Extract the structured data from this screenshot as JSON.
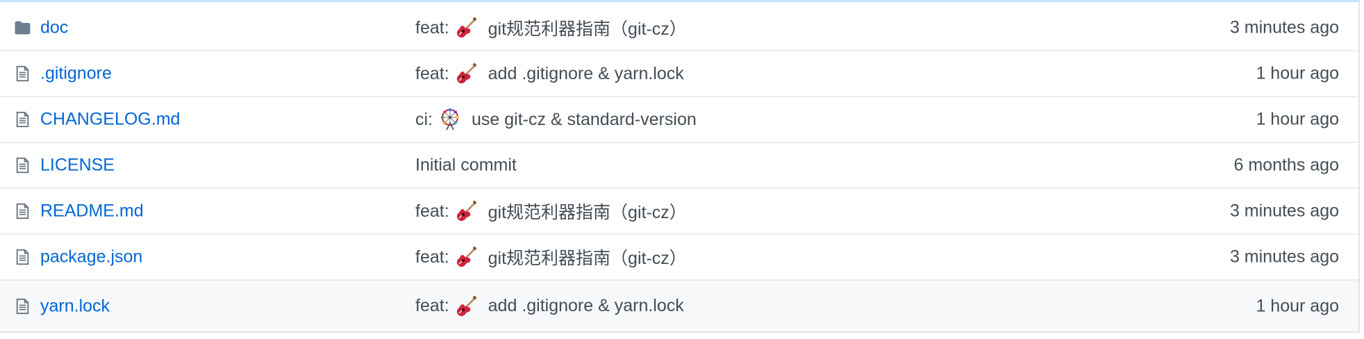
{
  "files": [
    {
      "type": "dir",
      "icon": "folder-icon",
      "name": "doc",
      "msg_prefix": "feat:",
      "emoji": "guitar-emoji",
      "msg_subject": "git规范利器指南（git-cz）",
      "age": "3 minutes ago"
    },
    {
      "type": "file",
      "icon": "file-icon",
      "name": ".gitignore",
      "msg_prefix": "feat:",
      "emoji": "guitar-emoji",
      "msg_subject": "add .gitignore & yarn.lock",
      "age": "1 hour ago"
    },
    {
      "type": "file",
      "icon": "file-icon",
      "name": "CHANGELOG.md",
      "msg_prefix": "ci:",
      "emoji": "ferris-wheel-emoji",
      "msg_subject": "use git-cz & standard-version",
      "age": "1 hour ago"
    },
    {
      "type": "file",
      "icon": "file-icon",
      "name": "LICENSE",
      "msg_prefix": "",
      "emoji": "",
      "msg_subject": "Initial commit",
      "age": "6 months ago"
    },
    {
      "type": "file",
      "icon": "file-icon",
      "name": "README.md",
      "msg_prefix": "feat:",
      "emoji": "guitar-emoji",
      "msg_subject": "git规范利器指南（git-cz）",
      "age": "3 minutes ago"
    },
    {
      "type": "file",
      "icon": "file-icon",
      "name": "package.json",
      "msg_prefix": "feat:",
      "emoji": "guitar-emoji",
      "msg_subject": "git规范利器指南（git-cz）",
      "age": "3 minutes ago"
    },
    {
      "type": "file",
      "icon": "file-icon",
      "name": "yarn.lock",
      "msg_prefix": "feat:",
      "emoji": "guitar-emoji",
      "msg_subject": "add .gitignore & yarn.lock",
      "age": "1 hour ago"
    }
  ],
  "colors": {
    "link": "#0366d6",
    "text_muted": "#444d56",
    "icon": "#6a737d",
    "hover_row": "#f6f8fa",
    "top_border": "#c8e1ff"
  }
}
